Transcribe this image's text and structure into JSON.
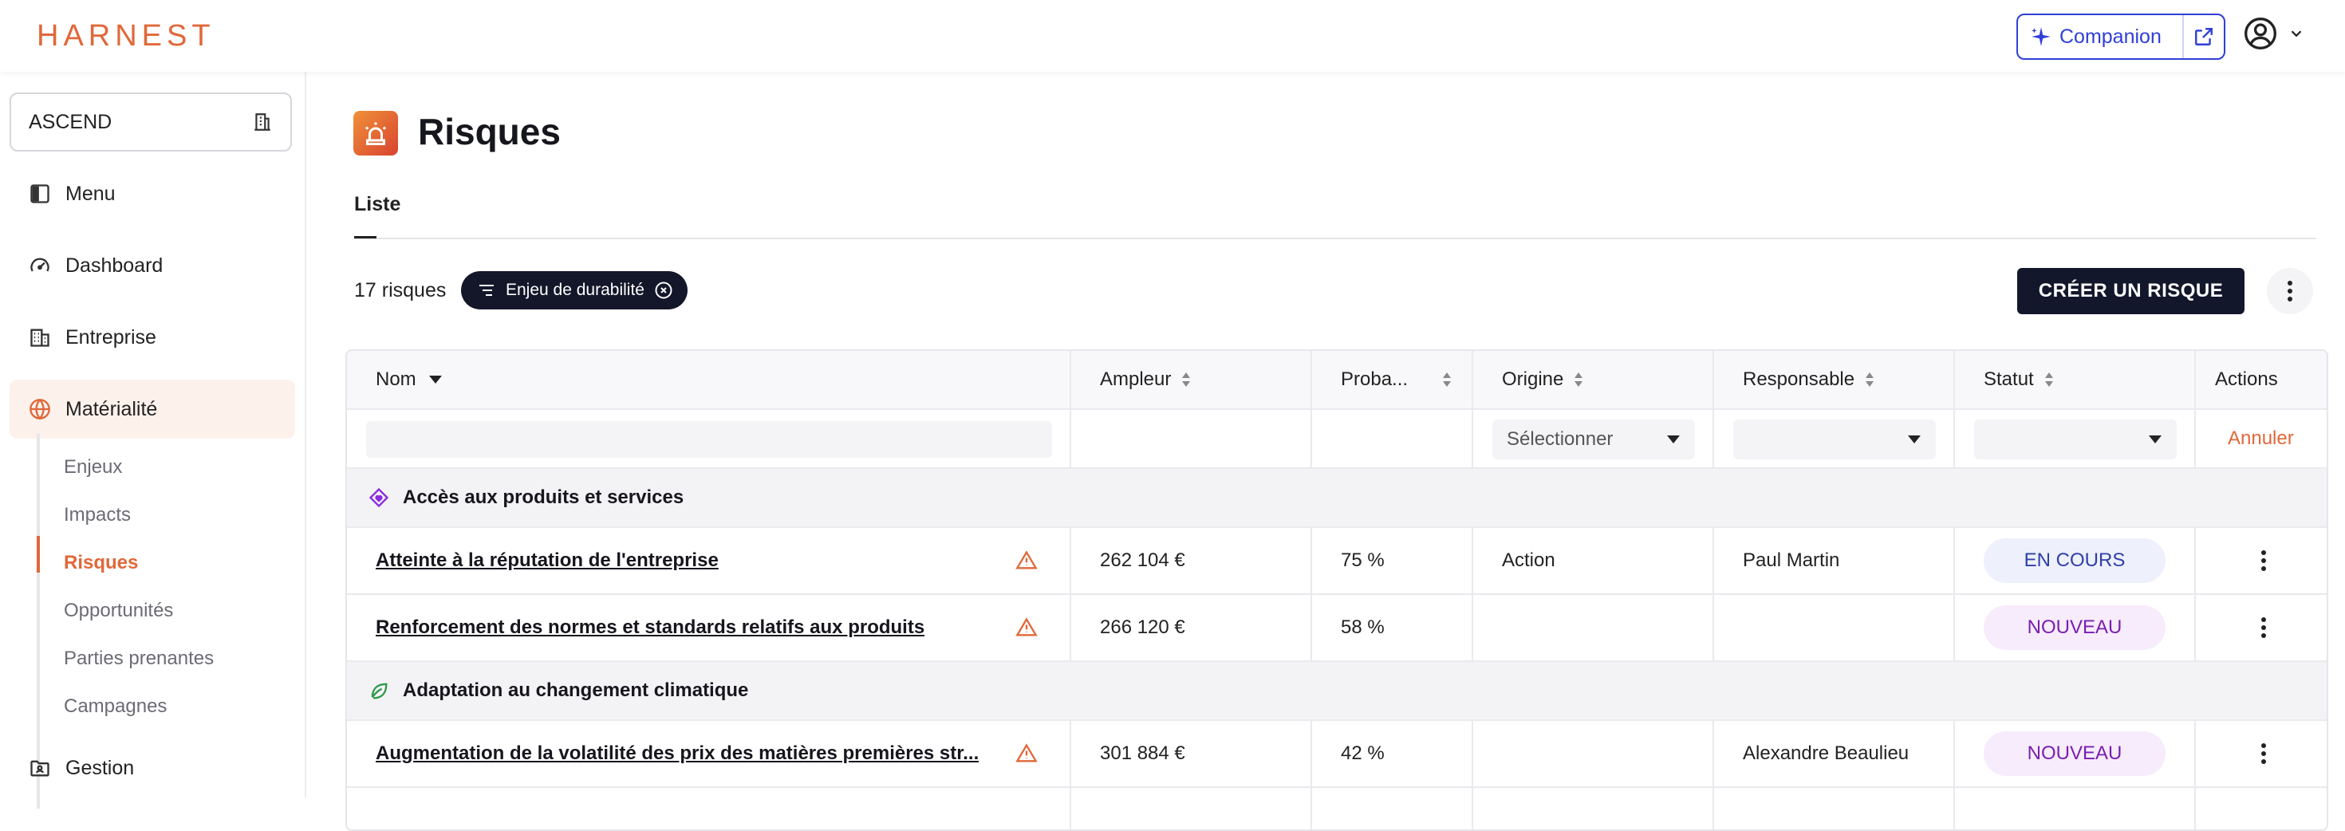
{
  "app": {
    "logo": "HARNEST"
  },
  "header": {
    "companion_label": "Companion"
  },
  "sidebar": {
    "org": "ASCEND",
    "items": [
      {
        "label": "Menu"
      },
      {
        "label": "Dashboard"
      },
      {
        "label": "Entreprise"
      },
      {
        "label": "Matérialité"
      },
      {
        "label": "Gestion"
      }
    ],
    "subitems": [
      {
        "label": "Enjeux"
      },
      {
        "label": "Impacts"
      },
      {
        "label": "Risques"
      },
      {
        "label": "Opportunités"
      },
      {
        "label": "Parties prenantes"
      },
      {
        "label": "Campagnes"
      }
    ]
  },
  "page": {
    "title": "Risques",
    "tab": "Liste",
    "count": "17 risques",
    "filter_chip": "Enjeu de durabilité",
    "create_button": "CRÉER UN RISQUE"
  },
  "table": {
    "columns": [
      "Nom",
      "Ampleur",
      "Proba...",
      "Origine",
      "Responsable",
      "Statut",
      "Actions"
    ],
    "filters": {
      "origine_placeholder": "Sélectionner",
      "cancel": "Annuler"
    },
    "groups": [
      {
        "label": "Accès aux produits et services",
        "rows": [
          {
            "nom": "Atteinte à la réputation de l'entreprise",
            "ampleur": "262 104 €",
            "proba": "75 %",
            "origine": "Action",
            "responsable": "Paul Martin",
            "statut": "EN COURS"
          },
          {
            "nom": "Renforcement des normes et standards relatifs aux produits",
            "ampleur": "266 120 €",
            "proba": "58 %",
            "origine": "",
            "responsable": "",
            "statut": "NOUVEAU"
          }
        ]
      },
      {
        "label": "Adaptation au changement climatique",
        "rows": [
          {
            "nom": "Augmentation de la volatilité des prix des matières premières str...",
            "ampleur": "301 884 €",
            "proba": "42 %",
            "origine": "",
            "responsable": "Alexandre Beaulieu",
            "statut": "NOUVEAU"
          }
        ]
      }
    ]
  },
  "colors": {
    "accent": "#e0683a",
    "primary": "#12172b",
    "companion": "#2f3fd6"
  }
}
